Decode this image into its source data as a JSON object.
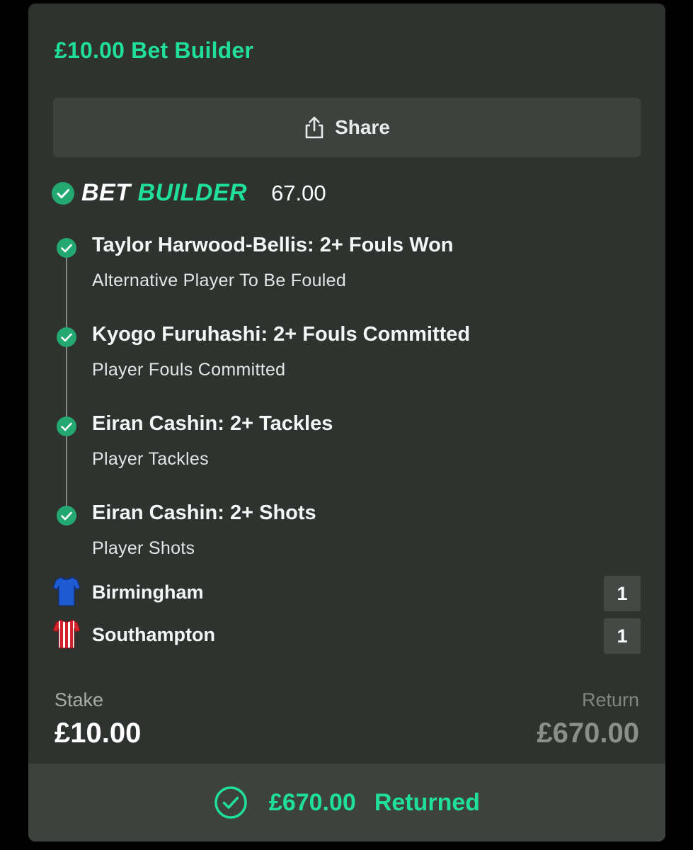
{
  "bet": {
    "title": "£10.00 Bet Builder",
    "share_label": "Share",
    "builder_logo_part1": "BET",
    "builder_logo_part2": "BUILDER",
    "odds": "67.00"
  },
  "legs": [
    {
      "title": "Taylor Harwood-Bellis: 2+ Fouls Won",
      "market": "Alternative Player To Be Fouled",
      "status": "won"
    },
    {
      "title": "Kyogo Furuhashi: 2+ Fouls Committed",
      "market": "Player Fouls Committed",
      "status": "won"
    },
    {
      "title": "Eiran Cashin: 2+ Tackles",
      "market": "Player Tackles",
      "status": "won"
    },
    {
      "title": "Eiran Cashin: 2+ Shots",
      "market": "Player Shots",
      "status": "won"
    }
  ],
  "teams": [
    {
      "name": "Birmingham",
      "score": "1",
      "shirt": "blue-shirt-icon"
    },
    {
      "name": "Southampton",
      "score": "1",
      "shirt": "red-white-striped-shirt-icon"
    }
  ],
  "stake": {
    "label": "Stake",
    "value": "£10.00"
  },
  "return": {
    "label": "Return",
    "value": "£670.00"
  },
  "footer": {
    "amount": "£670.00",
    "status": "Returned"
  },
  "colors": {
    "accent": "#1fdf9b",
    "card_bg": "#2f3330",
    "button_bg": "#3e423f",
    "check_bg": "#24a872"
  }
}
